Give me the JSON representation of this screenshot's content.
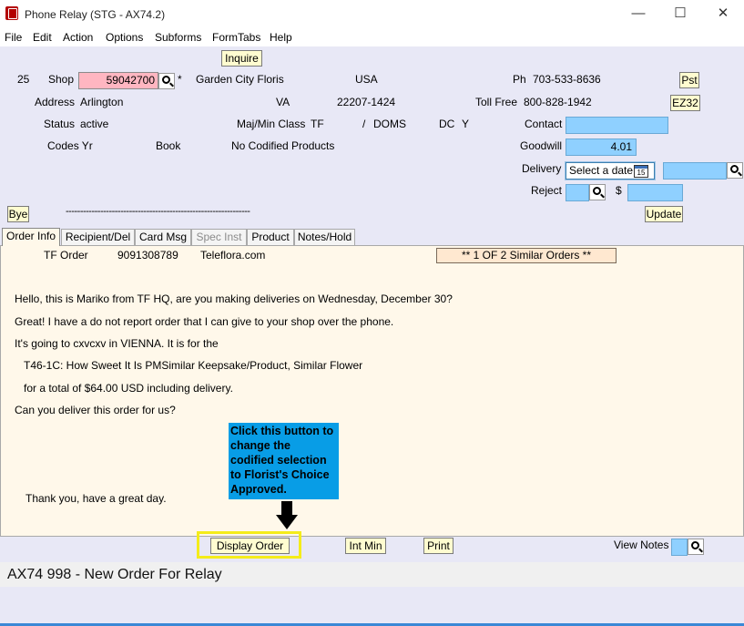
{
  "window": {
    "title": "Phone Relay (STG - AX74.2)",
    "minimize": "—",
    "maximize": "☐",
    "close": "✕"
  },
  "menu": [
    "File",
    "Edit",
    "Action",
    "Options",
    "Subforms",
    "FormTabs",
    "Help"
  ],
  "header": {
    "inquire_label": "Inquire",
    "row_number": "25",
    "shop_label": "Shop",
    "shop_value": "59042700",
    "asterisk": "*",
    "shop_name": "Garden City Floris",
    "country": "USA",
    "ph_label": "Ph",
    "ph_value": "703-533-8636",
    "pst_label": "Pst",
    "address_label": "Address",
    "address_value": "Arlington",
    "state": "VA",
    "zip": "22207-1424",
    "tollfree_label": "Toll Free",
    "tollfree_value": "800-828-1942",
    "ez32_label": "EZ32",
    "status_label": "Status",
    "status_value": "active",
    "majmin_label": "Maj/Min Class",
    "maj_value": "TF",
    "slash": "/",
    "min_value": "DOMS",
    "dc_label": "DC",
    "dc_value": "Y",
    "contact_label": "Contact",
    "codes_label": "Codes Yr",
    "book_label": "Book",
    "codified_text": "No Codified Products",
    "goodwill_label": "Goodwill",
    "goodwill_value": "4.01",
    "delivery_label": "Delivery",
    "delivery_placeholder": "Select a date",
    "calendar_day": "15",
    "reject_label": "Reject",
    "dollar": "$",
    "bye_label": "Bye",
    "dashes": "----------------------------------------------------------------",
    "update_label": "Update"
  },
  "tabs": [
    {
      "label": "Order Info",
      "active": true
    },
    {
      "label": "Recipient/Del"
    },
    {
      "label": "Card Msg"
    },
    {
      "label": "Spec Inst",
      "disabled": true
    },
    {
      "label": "Product"
    },
    {
      "label": "Notes/Hold"
    }
  ],
  "order": {
    "tf_label": "TF Order",
    "tf_number": "9091308789",
    "source": "Teleflora.com",
    "similar": "**  1 OF  2 Similar Orders **",
    "script": [
      "Hello, this is Mariko from TF HQ, are you making deliveries on Wednesday, December 30?",
      "Great! I have a do not report order that I can give to your shop over the phone.",
      "It's going to cxvcxv in VIENNA.  It is for the",
      "T46-1C: How Sweet It Is PMSimilar Keepsake/Product, Similar Flower",
      "for a total of    $64.00 USD including delivery.",
      "Can you deliver this order for us?",
      "Thank you, have a great day."
    ],
    "callout": "Click this button to change the codified selection to Florist's Choice Approved."
  },
  "footer": {
    "display_order": "Display Order",
    "int_min": "Int Min",
    "print": "Print",
    "view_notes": "View Notes"
  },
  "status": "AX74 998 - New Order For Relay",
  "colors": {
    "background": "#e8e8f6",
    "pink_field": "#ffb6c1",
    "blue_field": "#8fd0ff",
    "callout": "#089de6",
    "highlight": "#f4ec1a",
    "panel": "#fff8ea"
  }
}
